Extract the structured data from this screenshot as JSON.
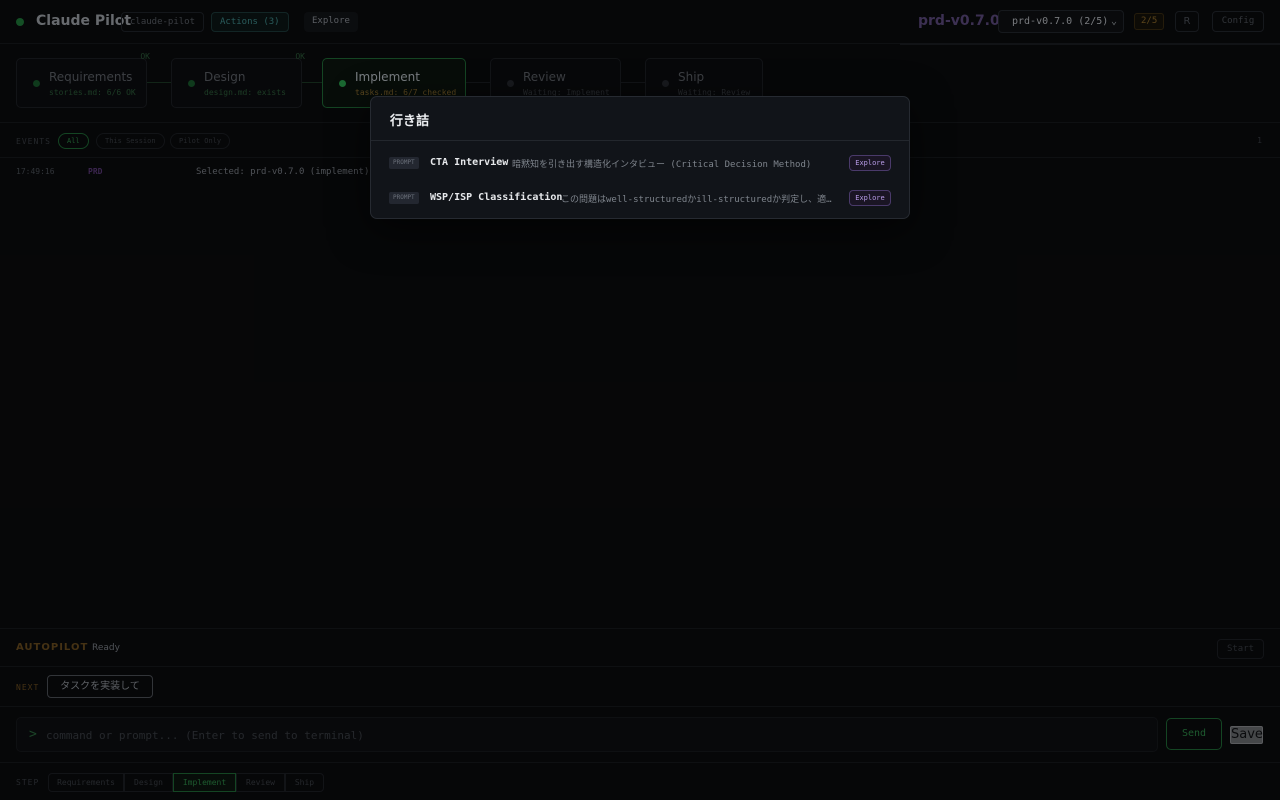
{
  "header": {
    "app_title": "Claude Pilot",
    "repo_chip": "claude-pilot",
    "actions_chip": "Actions (3)",
    "explore_chip": "Explore",
    "prd_title": "prd-v0.7.0",
    "prd_select_value": "prd-v0.7.0 (2/5)",
    "progress_badge": "2/5",
    "r_button": "R",
    "config_button": "Config"
  },
  "pipeline": {
    "stages": [
      {
        "name": "Requirements",
        "sub": "stories.md: 6/6 OK",
        "ok": "OK"
      },
      {
        "name": "Design",
        "sub": "design.md: exists",
        "ok": "OK"
      },
      {
        "name": "Implement",
        "sub": "tasks.md: 6/7 checked"
      },
      {
        "name": "Review",
        "sub": "Waiting: Implement"
      },
      {
        "name": "Ship",
        "sub": "Waiting: Review"
      }
    ]
  },
  "events": {
    "label": "EVENTS",
    "filters": [
      "All",
      "This Session",
      "Pilot Only"
    ],
    "count": "1",
    "rows": [
      {
        "time": "17:49:16",
        "tag": "PRD",
        "message": "Selected: prd-v0.7.0 (implement)"
      }
    ]
  },
  "autopilot": {
    "label": "AUTOPILOT",
    "status": "Ready",
    "start_button": "Start"
  },
  "next": {
    "label": "NEXT",
    "button": "タスクを実装して"
  },
  "command": {
    "prompt_symbol": ">",
    "placeholder": "command or prompt... (Enter to send to terminal)",
    "send_button": "Send",
    "save_button": "Save"
  },
  "step": {
    "label": "STEP",
    "buttons": [
      "Requirements",
      "Design",
      "Implement",
      "Review",
      "Ship"
    ]
  },
  "modal": {
    "title": "行き詰",
    "items": [
      {
        "badge": "PROMPT",
        "name": "CTA Interview",
        "description": "暗黙知を引き出す構造化インタビュー (Critical Decision Method)",
        "action": "Explore"
      },
      {
        "badge": "PROMPT",
        "name": "WSP/ISP Classification",
        "description": "この問題はwell-structuredかill-structuredか判定し、適切な戦略を選ぶ",
        "action": "Explore"
      }
    ]
  },
  "colors": {
    "accent_green": "#2aa24e",
    "accent_purple": "#b79be6",
    "accent_amber": "#8d6a2a",
    "background": "#0a0b0d"
  }
}
